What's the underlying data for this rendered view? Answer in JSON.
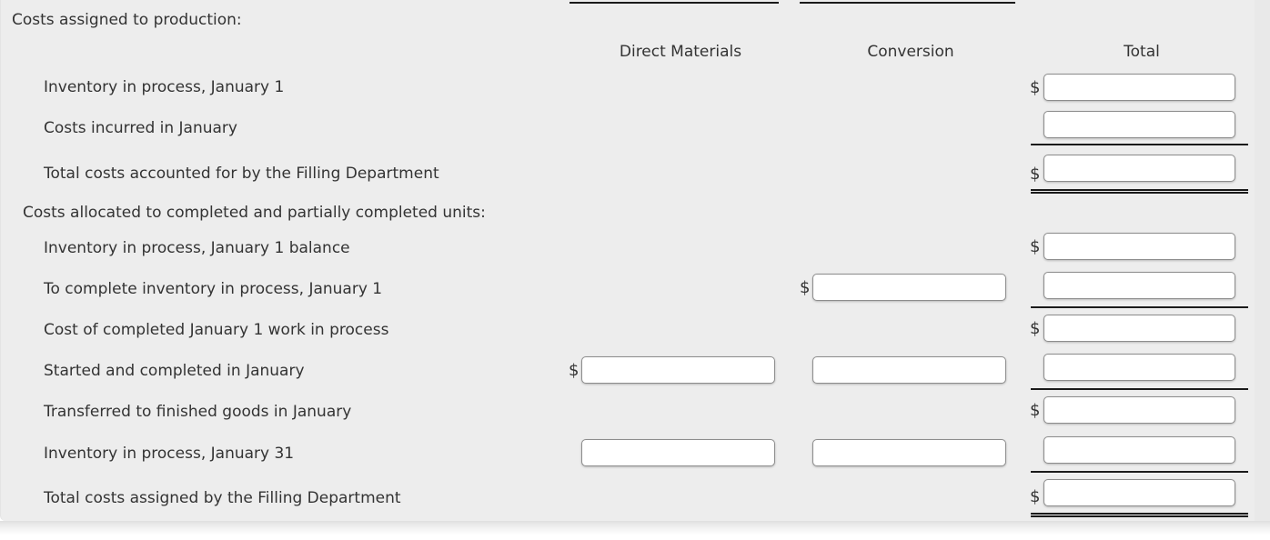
{
  "panel": {
    "background_color": "#ededed",
    "page_background_color": "#ffffff",
    "text_color": "#333333",
    "rule_color": "#1a1a1a",
    "input_border_color": "#8d8d8d",
    "input_background_color": "#ffffff"
  },
  "columns": {
    "direct_materials": "Direct Materials",
    "conversion": "Conversion",
    "total": "Total"
  },
  "sections": {
    "costs_assigned": "Costs assigned to production:",
    "costs_allocated": "Costs allocated to completed and partially completed units:"
  },
  "currency_symbol": "$",
  "rows": [
    {
      "label": "Inventory in process, January 1",
      "direct_materials": {
        "input": false,
        "dollar": false,
        "value": ""
      },
      "conversion": {
        "input": false,
        "dollar": false,
        "value": ""
      },
      "total": {
        "input": true,
        "dollar": true,
        "value": ""
      }
    },
    {
      "label": "Costs incurred in January",
      "direct_materials": {
        "input": false,
        "dollar": false,
        "value": ""
      },
      "conversion": {
        "input": false,
        "dollar": false,
        "value": ""
      },
      "total": {
        "input": true,
        "dollar": false,
        "value": ""
      }
    },
    {
      "label": "Total costs accounted for by the Filling Department",
      "direct_materials": {
        "input": false,
        "dollar": false,
        "value": ""
      },
      "conversion": {
        "input": false,
        "dollar": false,
        "value": ""
      },
      "total": {
        "input": true,
        "dollar": true,
        "value": ""
      }
    },
    {
      "label": "Inventory in process, January 1 balance",
      "direct_materials": {
        "input": false,
        "dollar": false,
        "value": ""
      },
      "conversion": {
        "input": false,
        "dollar": false,
        "value": ""
      },
      "total": {
        "input": true,
        "dollar": true,
        "value": ""
      }
    },
    {
      "label": "To complete inventory in process, January 1",
      "direct_materials": {
        "input": false,
        "dollar": false,
        "value": ""
      },
      "conversion": {
        "input": true,
        "dollar": true,
        "value": ""
      },
      "total": {
        "input": true,
        "dollar": false,
        "value": ""
      }
    },
    {
      "label": "Cost of completed January 1 work in process",
      "direct_materials": {
        "input": false,
        "dollar": false,
        "value": ""
      },
      "conversion": {
        "input": false,
        "dollar": false,
        "value": ""
      },
      "total": {
        "input": true,
        "dollar": true,
        "value": ""
      }
    },
    {
      "label": "Started and completed in January",
      "direct_materials": {
        "input": true,
        "dollar": true,
        "value": ""
      },
      "conversion": {
        "input": true,
        "dollar": false,
        "value": ""
      },
      "total": {
        "input": true,
        "dollar": false,
        "value": ""
      }
    },
    {
      "label": "Transferred to finished goods in January",
      "direct_materials": {
        "input": false,
        "dollar": false,
        "value": ""
      },
      "conversion": {
        "input": false,
        "dollar": false,
        "value": ""
      },
      "total": {
        "input": true,
        "dollar": true,
        "value": ""
      }
    },
    {
      "label": "Inventory in process, January 31",
      "direct_materials": {
        "input": true,
        "dollar": false,
        "value": ""
      },
      "conversion": {
        "input": true,
        "dollar": false,
        "value": ""
      },
      "total": {
        "input": true,
        "dollar": false,
        "value": ""
      }
    },
    {
      "label": "Total costs assigned by the Filling Department",
      "direct_materials": {
        "input": false,
        "dollar": false,
        "value": ""
      },
      "conversion": {
        "input": false,
        "dollar": false,
        "value": ""
      },
      "total": {
        "input": true,
        "dollar": true,
        "value": ""
      }
    }
  ]
}
